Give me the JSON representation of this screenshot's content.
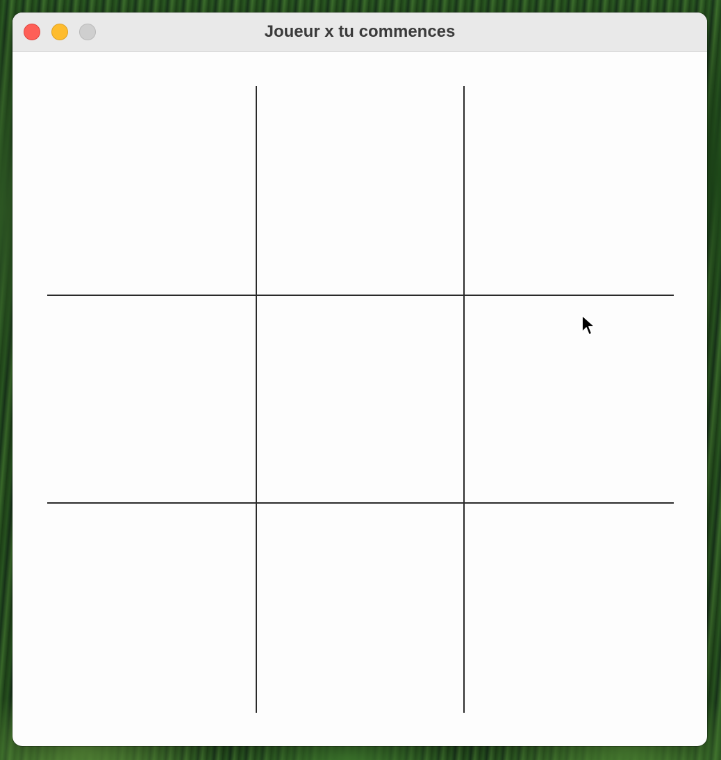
{
  "window": {
    "title": "Joueur x tu commences",
    "traffic_lights": {
      "close_color": "#fe5f57",
      "minimize_color": "#febc2e",
      "zoom_color": "#cfcfcf"
    }
  },
  "board": {
    "rows": 3,
    "cols": 3,
    "line_color": "#2a2a2a",
    "cells": [
      [
        "",
        "",
        ""
      ],
      [
        "",
        "",
        ""
      ],
      [
        "",
        "",
        ""
      ]
    ]
  },
  "cursor": {
    "icon": "arrow-pointer"
  }
}
